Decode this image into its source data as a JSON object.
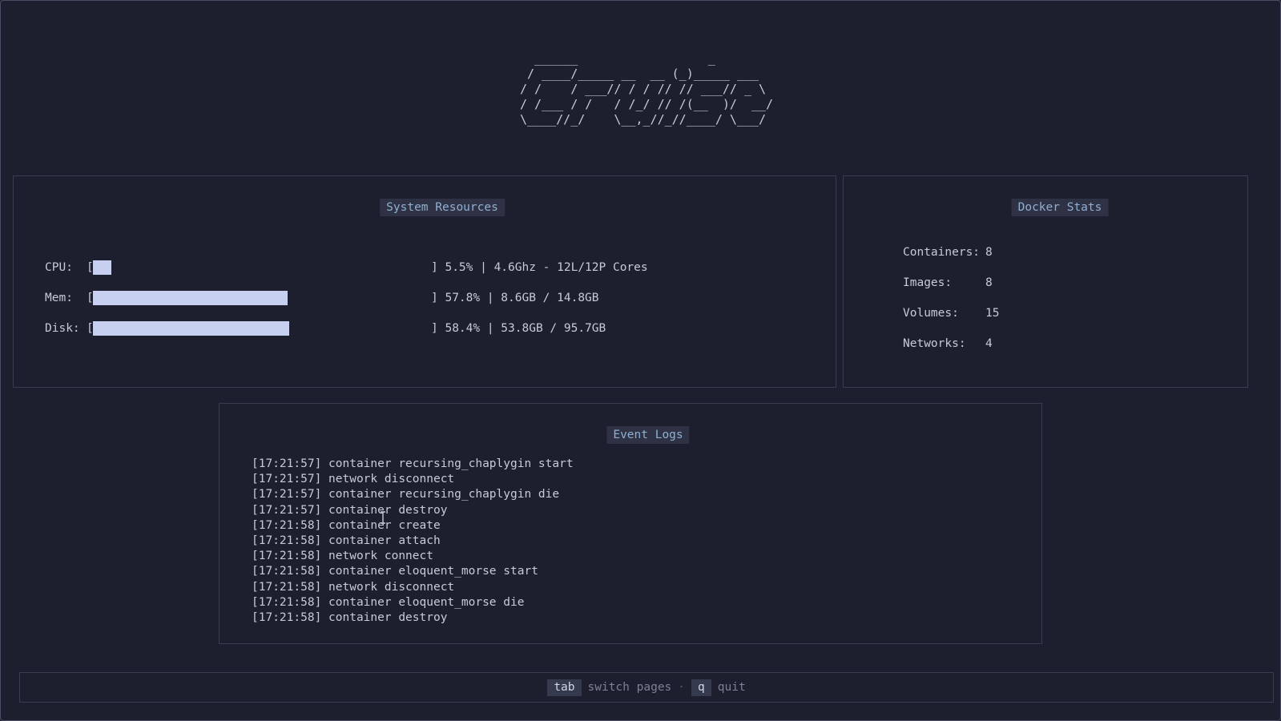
{
  "logo": "  ______                  _\n / ____/_____ __  __ (_)_____ ___\n/ /    / ___// / / // // ___// _ \\\n/ /___ / /   / /_/ // /(__  )/  __/\n\\____//_/    \\__,_//_//____/ \\___/",
  "colors": {
    "background": "#1e1f2e",
    "bar_fill": "#c8d0f2",
    "panel_title_bg": "#2e3244",
    "panel_title_fg": "#8fb0d2",
    "border": "#3a3c52"
  },
  "system_resources": {
    "title": "System Resources",
    "rows": [
      {
        "label": "CPU:",
        "bracket_open": "[",
        "percent": 5.5,
        "detail": "] 5.5% | 4.6Ghz - 12L/12P Cores"
      },
      {
        "label": "Mem:",
        "bracket_open": "[",
        "percent": 57.8,
        "detail": "] 57.8% | 8.6GB / 14.8GB"
      },
      {
        "label": "Disk:",
        "bracket_open": "[",
        "percent": 58.4,
        "detail": "] 58.4% | 53.8GB / 95.7GB"
      }
    ]
  },
  "docker_stats": {
    "title": "Docker Stats",
    "rows": [
      {
        "label": "Containers:",
        "value": "8"
      },
      {
        "label": "Images:",
        "value": "8"
      },
      {
        "label": "Volumes:",
        "value": "15"
      },
      {
        "label": "Networks:",
        "value": "4"
      }
    ]
  },
  "event_logs": {
    "title": "Event Logs",
    "lines": [
      "[17:21:57] container recursing_chaplygin start",
      "[17:21:57] network disconnect",
      "[17:21:57] container recursing_chaplygin die",
      "[17:21:57] container destroy",
      "[17:21:58] container create",
      "[17:21:58] container attach",
      "[17:21:58] network connect",
      "[17:21:58] container eloquent_morse start",
      "[17:21:58] network disconnect",
      "[17:21:58] container eloquent_morse die",
      "[17:21:58] container destroy"
    ]
  },
  "footer": {
    "tab_key": "tab",
    "tab_action": "switch pages",
    "separator": "·",
    "quit_key": "q",
    "quit_action": "quit"
  },
  "icons": {
    "cursor": "text-cursor-icon"
  }
}
